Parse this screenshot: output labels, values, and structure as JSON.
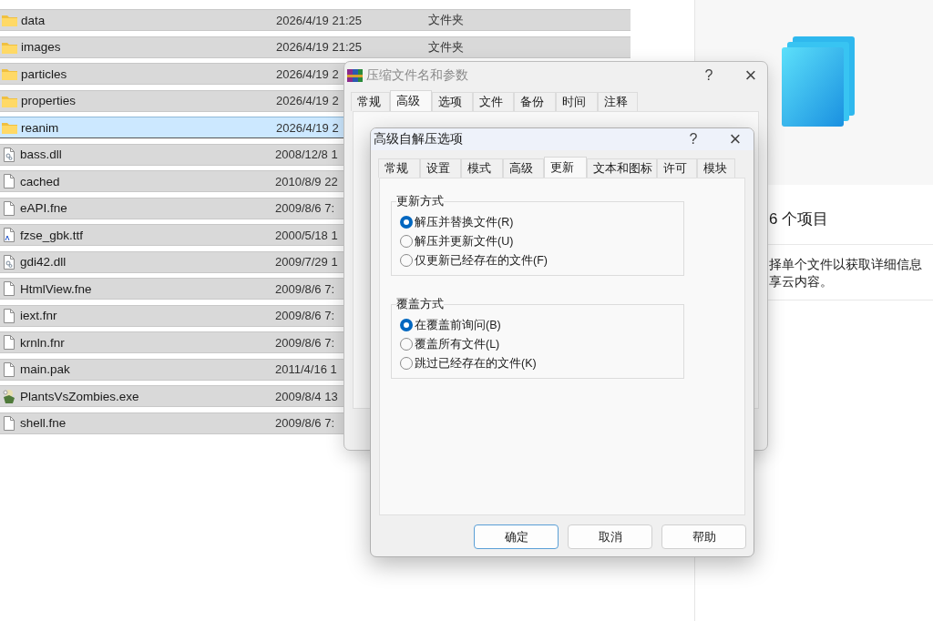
{
  "explorer": {
    "files": [
      {
        "name": "data",
        "kind": "folder",
        "date": "2026/4/19 21:25",
        "type": "文件夹",
        "selected": false
      },
      {
        "name": "images",
        "kind": "folder",
        "date": "2026/4/19 21:25",
        "type": "文件夹",
        "selected": false
      },
      {
        "name": "particles",
        "kind": "folder",
        "date": "2026/4/19 2",
        "selected": false
      },
      {
        "name": "properties",
        "kind": "folder",
        "date": "2026/4/19 2",
        "selected": false
      },
      {
        "name": "reanim",
        "kind": "folder",
        "date": "2026/4/19 2",
        "selected": true
      },
      {
        "name": "bass.dll",
        "kind": "dll",
        "date": "2008/12/8 1",
        "selected": false
      },
      {
        "name": "cached",
        "kind": "file",
        "date": "2010/8/9 22",
        "selected": false
      },
      {
        "name": "eAPI.fne",
        "kind": "file",
        "date": "2009/8/6 7:",
        "selected": false
      },
      {
        "name": "fzse_gbk.ttf",
        "kind": "font",
        "date": "2000/5/18 1",
        "selected": false
      },
      {
        "name": "gdi42.dll",
        "kind": "dll",
        "date": "2009/7/29 1",
        "selected": false
      },
      {
        "name": "HtmlView.fne",
        "kind": "file",
        "date": "2009/8/6 7:",
        "selected": false
      },
      {
        "name": "iext.fnr",
        "kind": "file",
        "date": "2009/8/6 7:",
        "selected": false
      },
      {
        "name": "krnln.fnr",
        "kind": "file",
        "date": "2009/8/6 7:",
        "selected": false
      },
      {
        "name": "main.pak",
        "kind": "file",
        "date": "2011/4/16 1",
        "selected": false
      },
      {
        "name": "PlantsVsZombies.exe",
        "kind": "exe",
        "date": "2009/8/4 13",
        "selected": false
      },
      {
        "name": "shell.fne",
        "kind": "file",
        "date": "2009/8/6 7:",
        "selected": false
      }
    ]
  },
  "details": {
    "count": "6 个项目",
    "hint_lines": [
      "择单个文件以获取详细信息",
      "享云内容。"
    ]
  },
  "rear_dialog": {
    "title": "压缩文件名和参数",
    "help": "?",
    "close": "×",
    "tabs": [
      {
        "label": "常规",
        "selected": false
      },
      {
        "label": "高级",
        "selected": true
      },
      {
        "label": "选项",
        "selected": false
      },
      {
        "label": "文件",
        "selected": false
      },
      {
        "label": "备份",
        "selected": false
      },
      {
        "label": "时间",
        "selected": false
      },
      {
        "label": "注释",
        "selected": false
      }
    ]
  },
  "front_dialog": {
    "title": "高级自解压选项",
    "help": "?",
    "close": "×",
    "tabs": [
      {
        "label": "常规",
        "selected": false
      },
      {
        "label": "设置",
        "selected": false
      },
      {
        "label": "模式",
        "selected": false
      },
      {
        "label": "高级",
        "selected": false
      },
      {
        "label": "更新",
        "selected": true
      },
      {
        "label": "文本和图标",
        "selected": false
      },
      {
        "label": "许可",
        "selected": false
      },
      {
        "label": "模块",
        "selected": false
      }
    ],
    "groups": [
      {
        "title": "更新方式",
        "options": [
          {
            "label": "解压并替换文件(R)",
            "selected": true
          },
          {
            "label": "解压并更新文件(U)",
            "selected": false
          },
          {
            "label": "仅更新已经存在的文件(F)",
            "selected": false
          }
        ]
      },
      {
        "title": "覆盖方式",
        "options": [
          {
            "label": "在覆盖前询问(B)",
            "selected": true
          },
          {
            "label": "覆盖所有文件(L)",
            "selected": false
          },
          {
            "label": "跳过已经存在的文件(K)",
            "selected": false
          }
        ]
      }
    ],
    "buttons": [
      {
        "label": "确定",
        "default": true
      },
      {
        "label": "取消",
        "default": false
      },
      {
        "label": "帮助",
        "default": false
      }
    ]
  }
}
